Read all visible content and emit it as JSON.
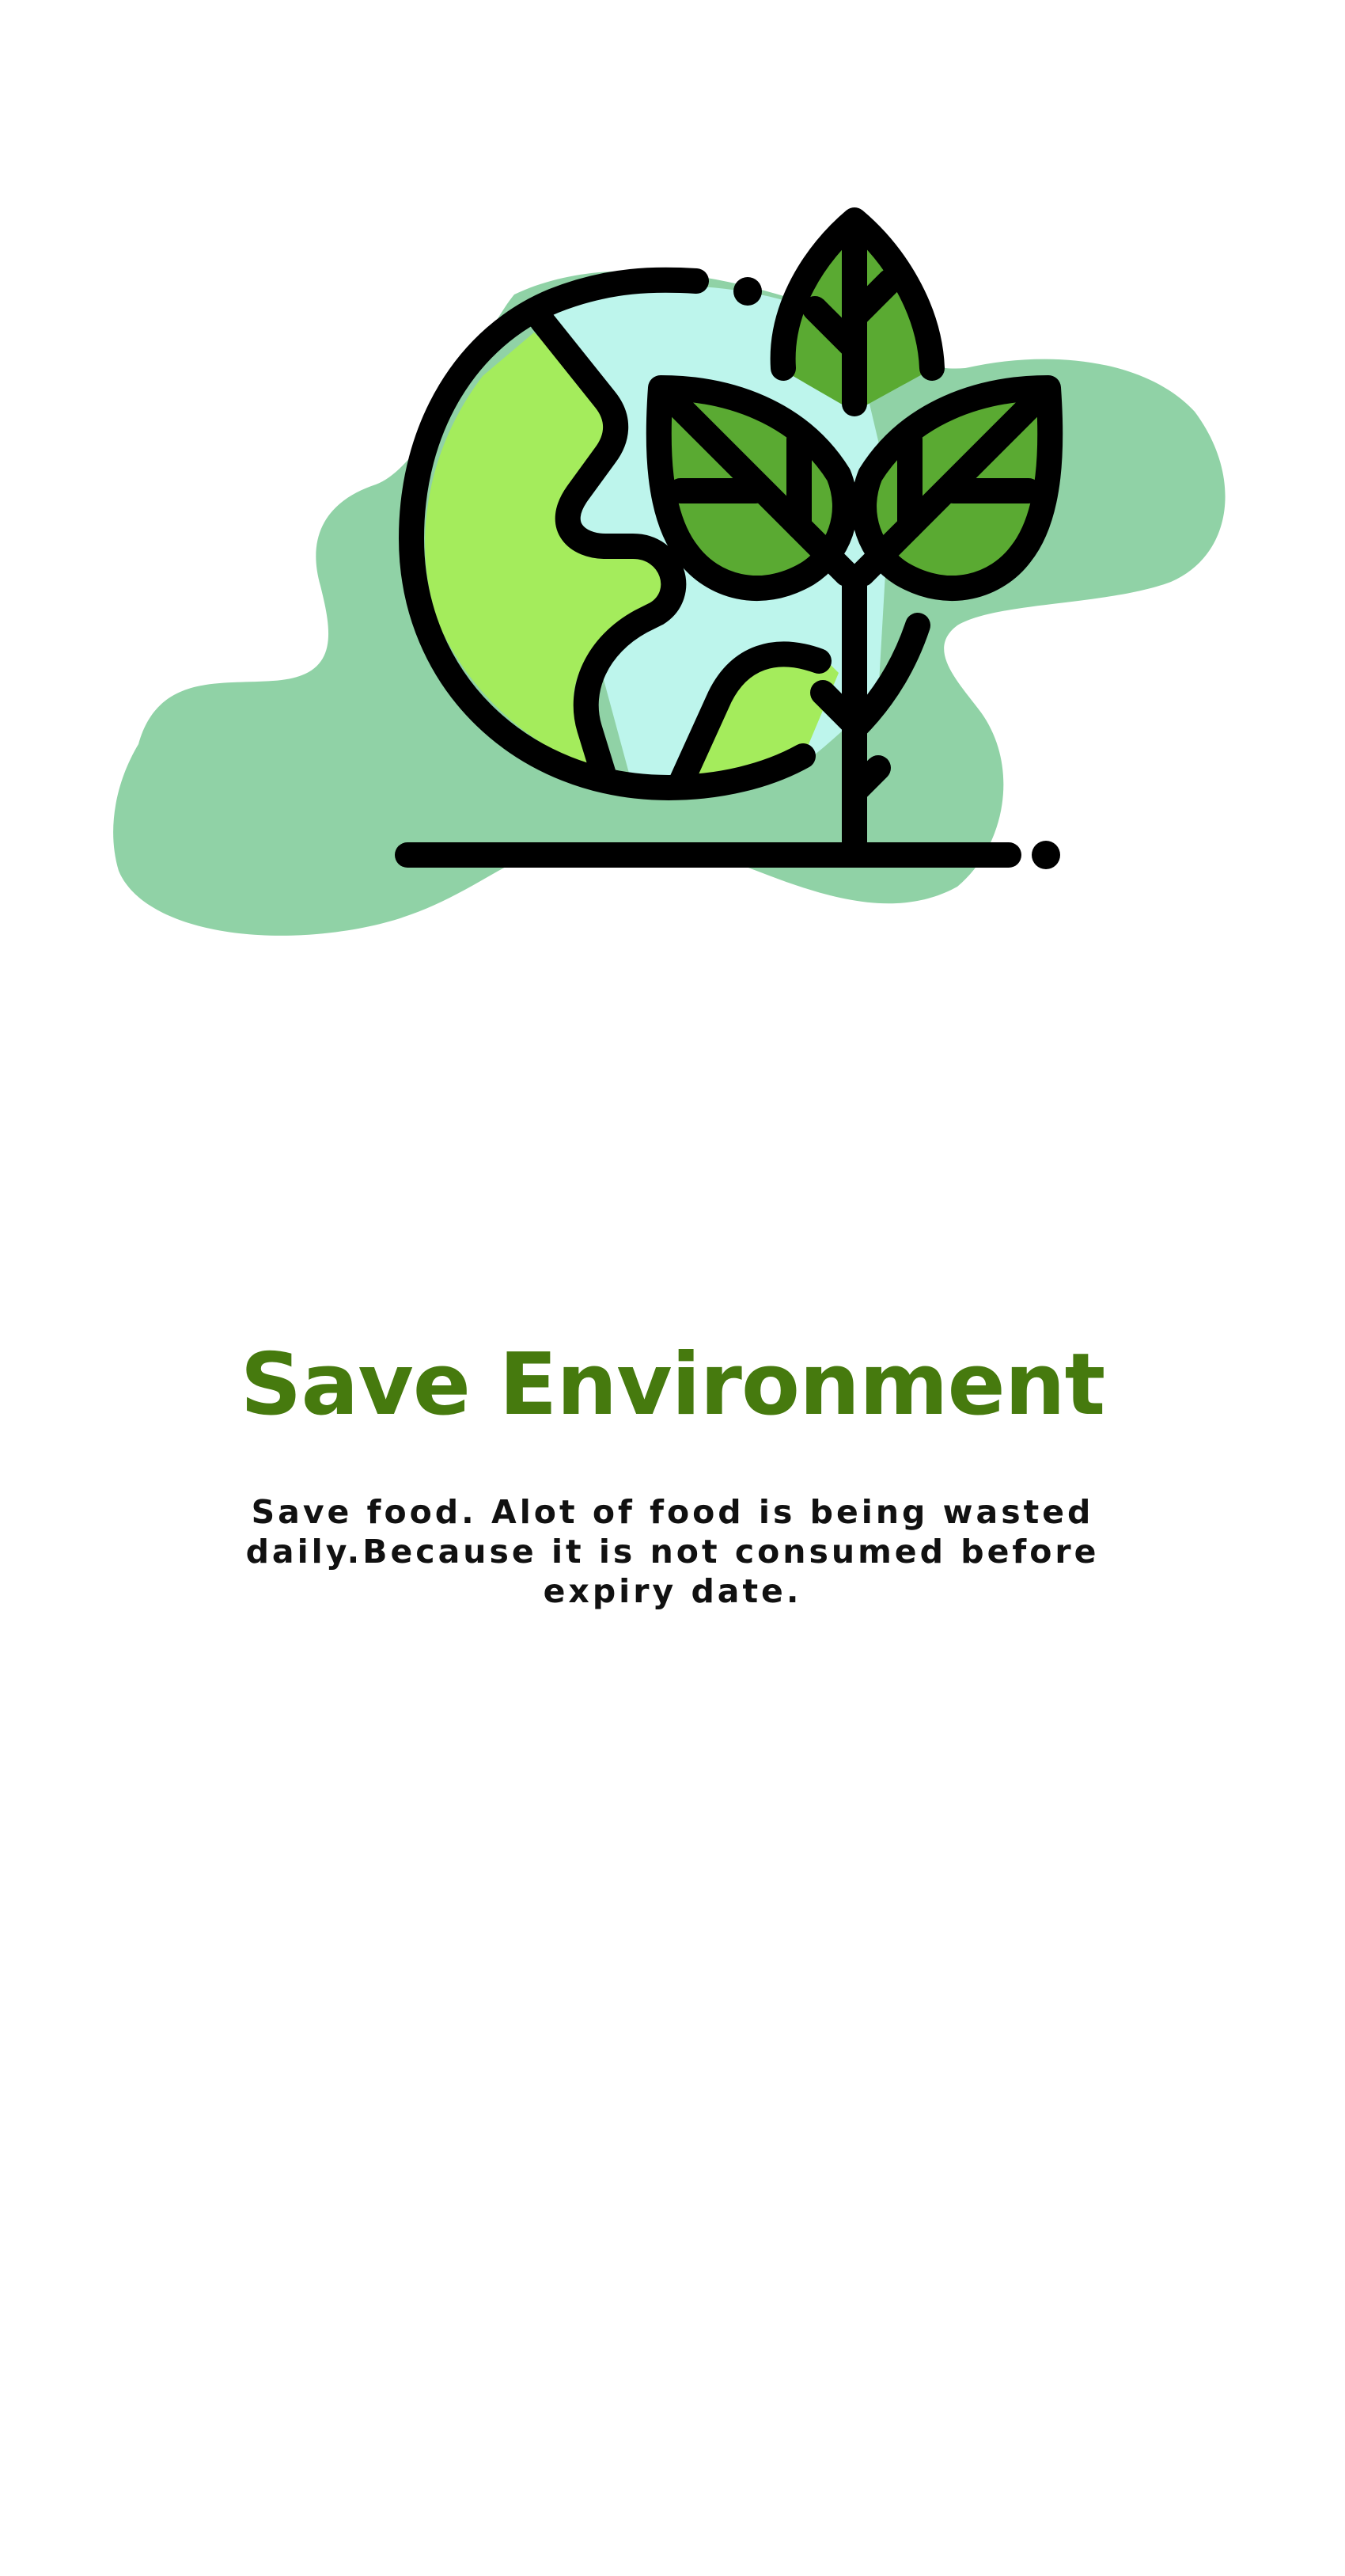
{
  "onboarding": {
    "title": "Save Environment",
    "description": "Save food. Alot of food is being wasted daily.Because it is not consumed before expiry date."
  },
  "illustration": {
    "icon": "earth-with-plant-icon",
    "colors": {
      "blob": "#90d2a6",
      "sky": "#bdf5ec",
      "land": "#a4ec5c",
      "leaf": "#5aaa32",
      "outline": "#000000"
    }
  },
  "theme": {
    "title_color": "#467a0e",
    "text_color": "#111111",
    "background": "#ffffff"
  }
}
